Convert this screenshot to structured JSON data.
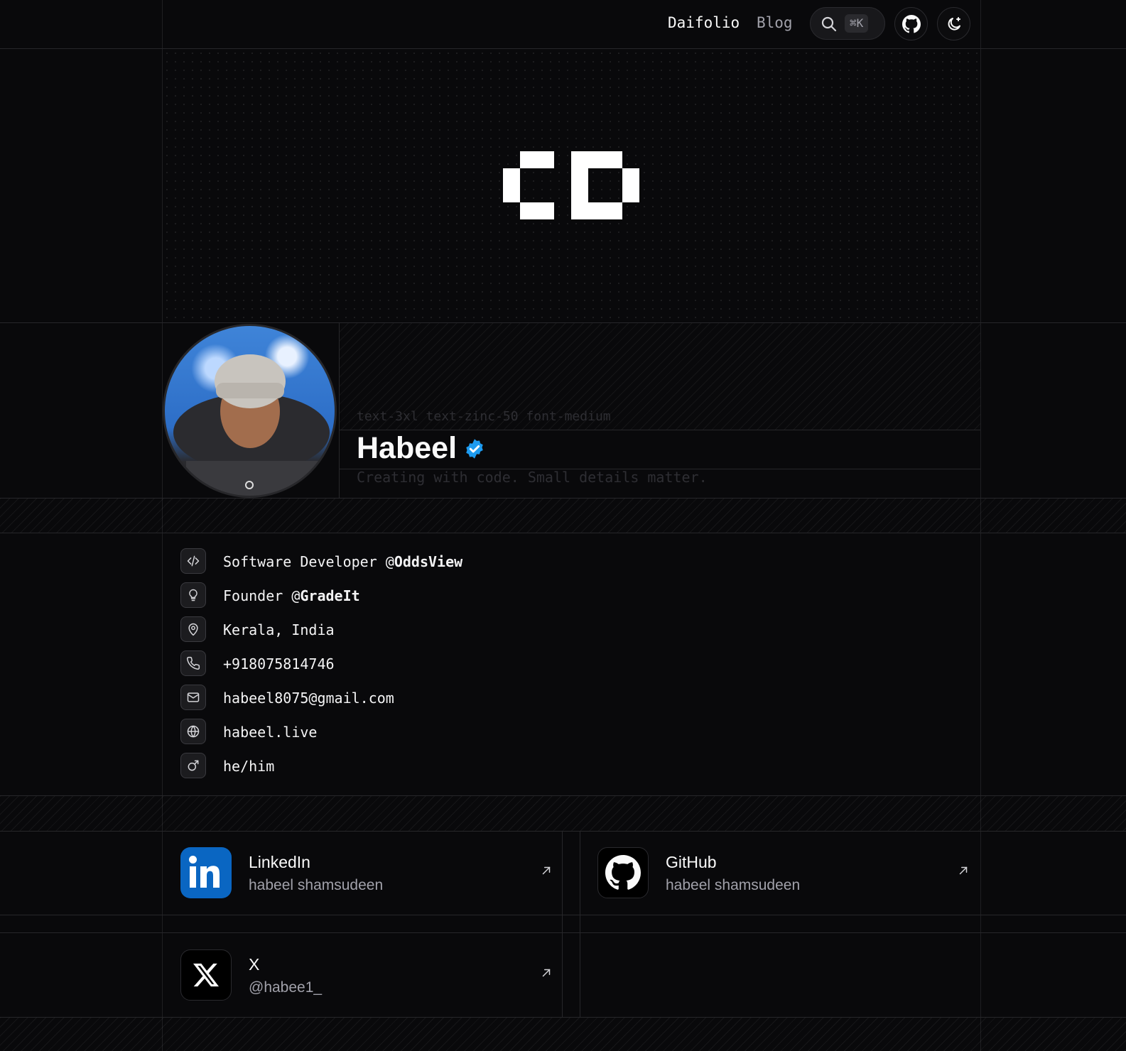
{
  "header": {
    "brand": "Daifolio",
    "blog": "Blog",
    "search_shortcut": "⌘K",
    "icons": [
      "search-icon",
      "github-icon",
      "moon-icon"
    ]
  },
  "profile": {
    "name": "Habeel",
    "class_hint": "text-3xl text-zinc-50 font-medium",
    "tagline": "Creating with code. Small details matter.",
    "verified_color": "#1d9bf0"
  },
  "info": [
    {
      "icon": "code-icon",
      "text": "Software Developer @",
      "strong": "OddsView"
    },
    {
      "icon": "lightbulb-icon",
      "text": "Founder @",
      "strong": "GradeIt"
    },
    {
      "icon": "map-pin-icon",
      "text": "Kerala, India",
      "strong": ""
    },
    {
      "icon": "phone-icon",
      "text": "+918075814746",
      "strong": ""
    },
    {
      "icon": "mail-icon",
      "text": "habeel8075@gmail.com",
      "strong": ""
    },
    {
      "icon": "globe-icon",
      "text": "habeel.live",
      "strong": ""
    },
    {
      "icon": "male-icon",
      "text": "he/him",
      "strong": ""
    }
  ],
  "social": [
    {
      "title": "LinkedIn",
      "handle": "habeel shamsudeen",
      "icon": "linkedin-icon",
      "color": "#0a66c2"
    },
    {
      "title": "GitHub",
      "handle": "habeel shamsudeen",
      "icon": "github-icon",
      "color": "#000000"
    },
    {
      "title": "X",
      "handle": "@habee1_",
      "icon": "x-icon",
      "color": "#000000"
    }
  ]
}
